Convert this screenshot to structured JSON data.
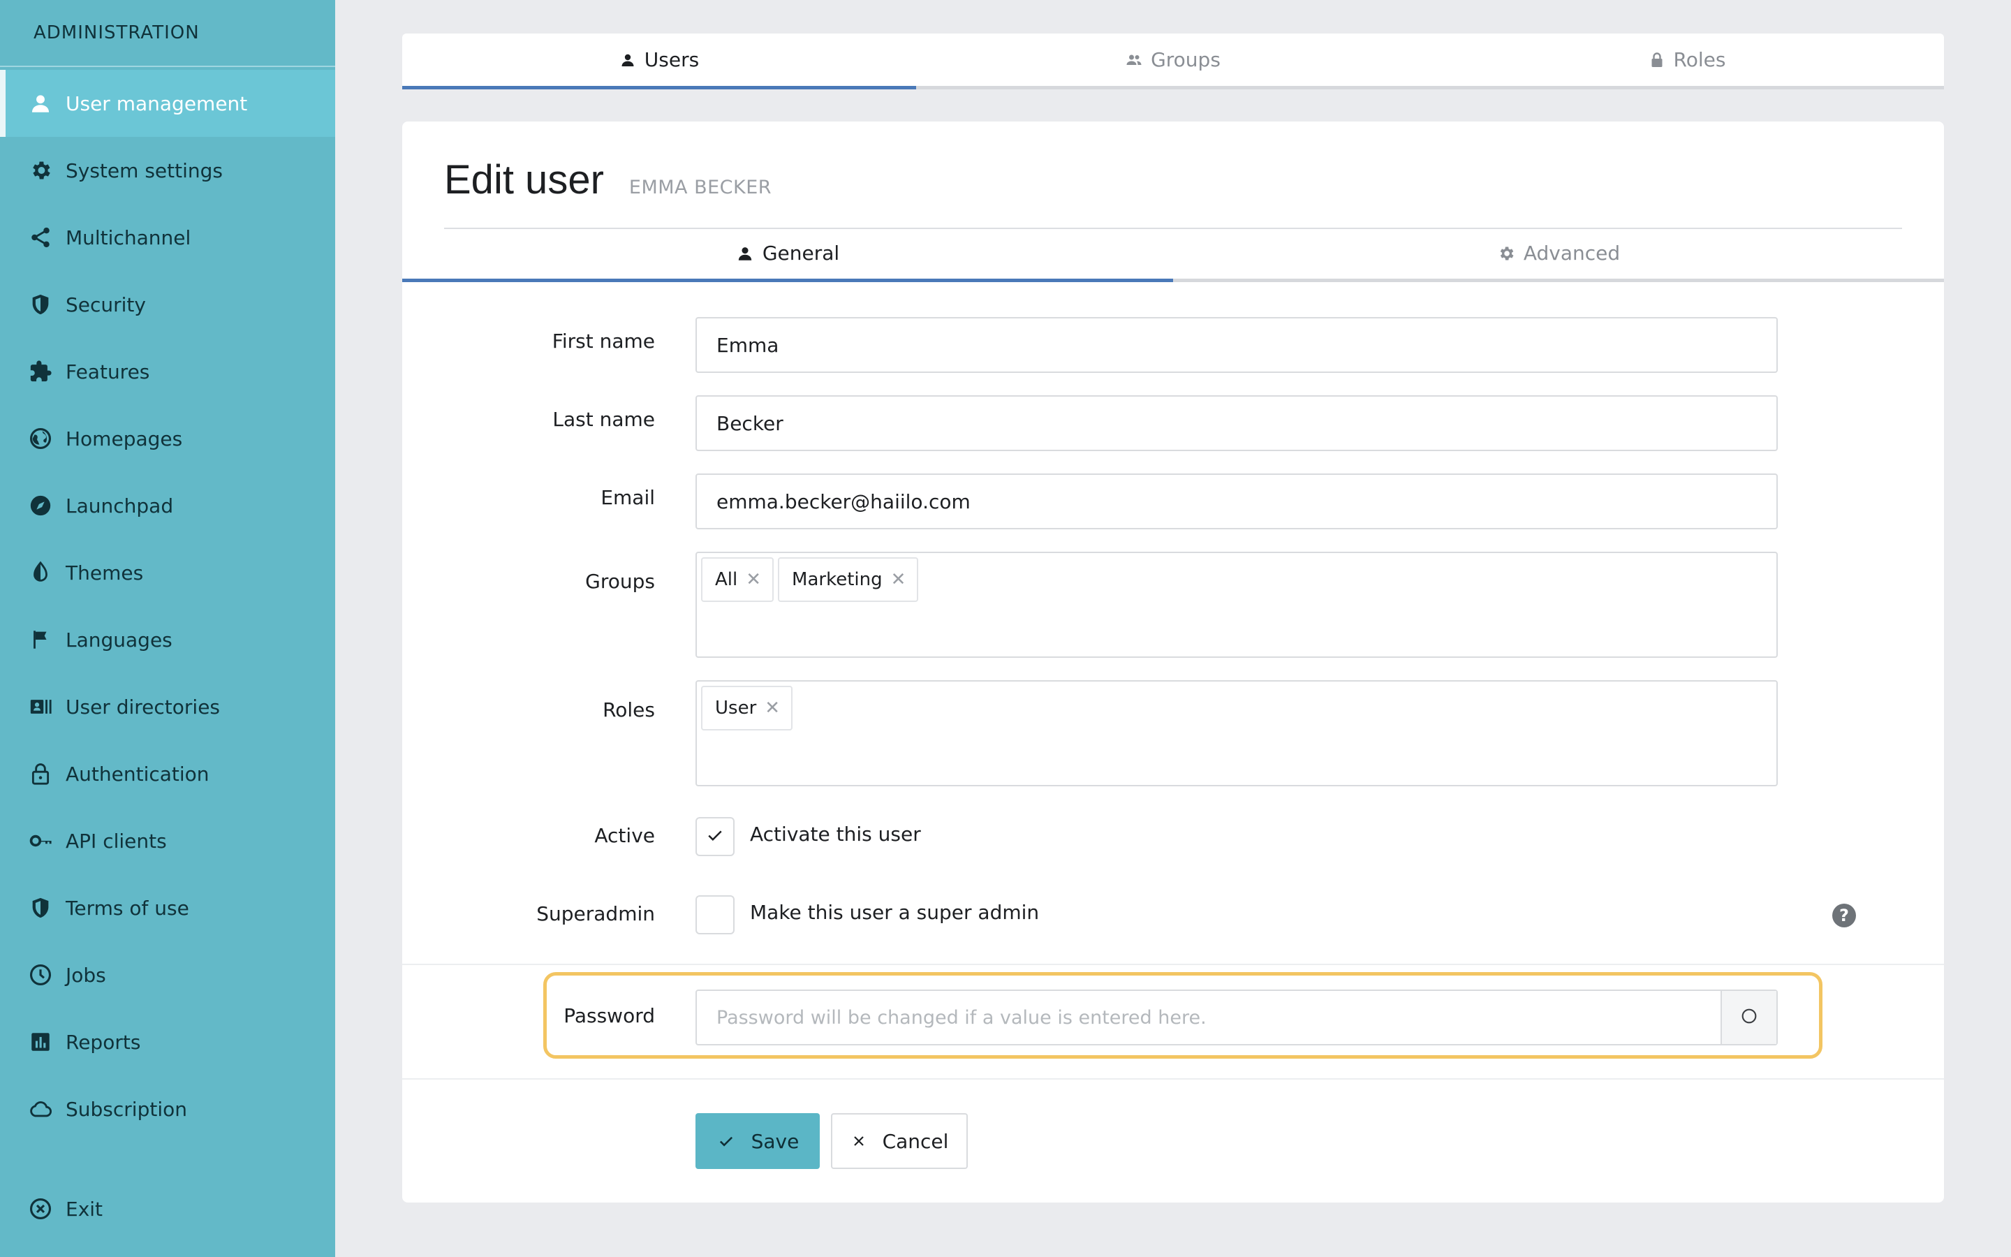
{
  "sidebar": {
    "heading": "ADMINISTRATION",
    "items": [
      {
        "label": "User management",
        "icon": "user-icon",
        "active": true
      },
      {
        "label": "System settings",
        "icon": "gear-icon"
      },
      {
        "label": "Multichannel",
        "icon": "share-icon"
      },
      {
        "label": "Security",
        "icon": "shield-icon"
      },
      {
        "label": "Features",
        "icon": "puzzle-icon"
      },
      {
        "label": "Homepages",
        "icon": "globe-icon"
      },
      {
        "label": "Launchpad",
        "icon": "compass-icon"
      },
      {
        "label": "Themes",
        "icon": "contrast-icon"
      },
      {
        "label": "Languages",
        "icon": "flag-icon"
      },
      {
        "label": "User directories",
        "icon": "directory-icon"
      },
      {
        "label": "Authentication",
        "icon": "lock-icon"
      },
      {
        "label": "API clients",
        "icon": "key-icon"
      },
      {
        "label": "Terms of use",
        "icon": "shield-icon"
      },
      {
        "label": "Jobs",
        "icon": "clock-icon"
      },
      {
        "label": "Reports",
        "icon": "bar-chart-icon"
      },
      {
        "label": "Subscription",
        "icon": "cloud-icon"
      },
      {
        "label": "Exit",
        "icon": "close-circle-icon"
      }
    ]
  },
  "top_tabs": [
    {
      "label": "Users",
      "icon": "user-icon",
      "active": true
    },
    {
      "label": "Groups",
      "icon": "users-icon"
    },
    {
      "label": "Roles",
      "icon": "lock-icon"
    }
  ],
  "card": {
    "title": "Edit user",
    "subtitle": "EMMA BECKER",
    "tabs": [
      {
        "label": "General",
        "icon": "user-icon",
        "active": true
      },
      {
        "label": "Advanced",
        "icon": "gear-icon"
      }
    ]
  },
  "form": {
    "first_name": {
      "label": "First name",
      "value": "Emma"
    },
    "last_name": {
      "label": "Last name",
      "value": "Becker"
    },
    "email": {
      "label": "Email",
      "value": "emma.becker@haiilo.com"
    },
    "groups": {
      "label": "Groups",
      "tags": [
        "All",
        "Marketing"
      ]
    },
    "roles": {
      "label": "Roles",
      "tags": [
        "User"
      ]
    },
    "active": {
      "label": "Active",
      "checkbox_label": "Activate this user",
      "checked": true
    },
    "superadmin": {
      "label": "Superadmin",
      "checkbox_label": "Make this user a super admin",
      "checked": false
    },
    "password": {
      "label": "Password",
      "placeholder": "Password will be changed if a value is entered here."
    }
  },
  "buttons": {
    "save": "Save",
    "cancel": "Cancel"
  },
  "colors": {
    "sidebar": "#63b9c8",
    "sidebar_active": "#6bc6d6",
    "tab_underline": "#4a79b8",
    "save_button": "#5bb6c6",
    "password_highlight": "#f3c562"
  }
}
